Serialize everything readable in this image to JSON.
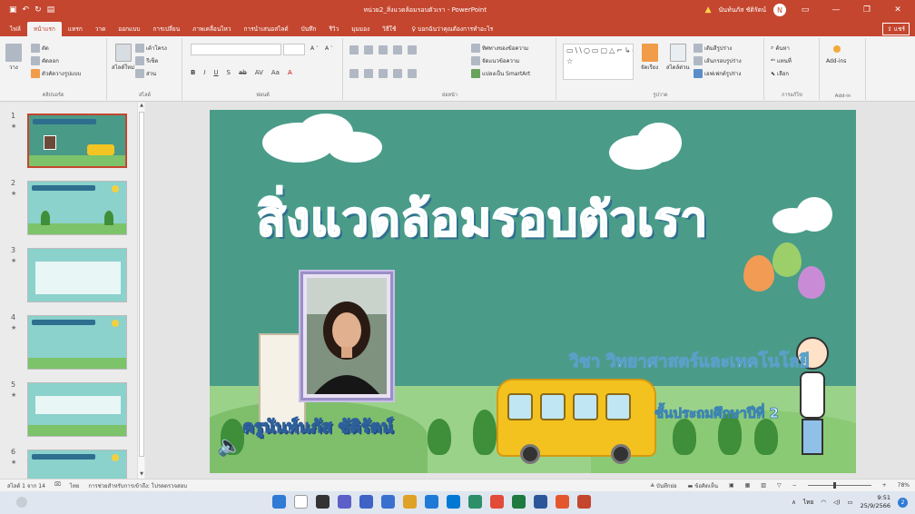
{
  "app": {
    "window_title": "หน่วย2_สิ่งแวดล้อมรอบตัวเรา - PowerPoint",
    "user_name": "นันท์นภัส ชัติรัตน์",
    "avatar_initial": "N",
    "warning_icon": "warning-icon",
    "accent_color": "#c4462f"
  },
  "quick_access": {
    "save_icon": "save-icon",
    "undo_icon": "undo-icon",
    "redo_icon": "redo-icon",
    "present_icon": "present-icon"
  },
  "ribbon_tabs": [
    {
      "label": "ไฟล์"
    },
    {
      "label": "หน้าแรก",
      "active": true
    },
    {
      "label": "แทรก"
    },
    {
      "label": "วาด"
    },
    {
      "label": "ออกแบบ"
    },
    {
      "label": "การเปลี่ยน"
    },
    {
      "label": "ภาพเคลื่อนไหว"
    },
    {
      "label": "การนำเสนอสไลด์"
    },
    {
      "label": "บันทึก"
    },
    {
      "label": "รีวิว"
    },
    {
      "label": "มุมมอง"
    },
    {
      "label": "วิธีใช้"
    }
  ],
  "tell_me": "บอกฉันว่าคุณต้องการทำอะไร",
  "share_label": "แชร์",
  "ribbon": {
    "clipboard": {
      "paste": "วาง",
      "cut": "ตัด",
      "copy": "คัดลอก",
      "format_painter": "ตัวคัดวางรูปแบบ",
      "label": "คลิปบอร์ด"
    },
    "slides": {
      "new_slide": "สไลด์ใหม่",
      "layout": "เค้าโครง",
      "reset": "รีเซ็ต",
      "section": "ส่วน",
      "label": "สไลด์"
    },
    "font": {
      "label": "ฟอนต์",
      "format_buttons": [
        "B",
        "I",
        "U",
        "S",
        "ab",
        "AV",
        "Aa",
        "A"
      ]
    },
    "paragraph": {
      "text_direction": "ทิศทางของข้อความ",
      "align_text": "จัดแนวข้อความ",
      "smartart": "แปลงเป็น SmartArt",
      "label": "ย่อหน้า"
    },
    "drawing": {
      "arrange": "จัดเรียง",
      "quick_styles": "สไตล์ด่วน",
      "shape_fill": "เติมสีรูปร่าง",
      "shape_outline": "เส้นกรอบรูปร่าง",
      "shape_effects": "เอฟเฟกต์รูปร่าง",
      "label": "รูปวาด"
    },
    "editing": {
      "find": "ค้นหา",
      "replace": "แทนที่",
      "select": "เลือก",
      "label": "การแก้ไข"
    },
    "addins": {
      "button": "Add-ins",
      "label": "Add-in"
    }
  },
  "thumbnails": [
    {
      "num": "1",
      "star": "★",
      "selected": true
    },
    {
      "num": "2",
      "star": "★"
    },
    {
      "num": "3",
      "star": "★"
    },
    {
      "num": "4",
      "star": "★"
    },
    {
      "num": "5",
      "star": "★"
    },
    {
      "num": "6",
      "star": "★"
    }
  ],
  "slide": {
    "title": "สิ่งแวดล้อมรอบตัวเรา",
    "subject": "วิชา วิทยาศาสตร์และเทคโนโลยี",
    "grade": "ชั้นประถมศึกษาปีที่ 2",
    "teacher": "ครูนันท์นภัส ชัติรัตน์",
    "background_color": "#4a9c89"
  },
  "status_bar": {
    "slide_info": "สไลด์ 1 จาก 14",
    "language": "ไทย",
    "accessibility": "การช่วยสำหรับการเข้าถึง: โปรดตรวจสอบ",
    "notes": "บันทึกย่อ",
    "comments": "ข้อคิดเห็น",
    "zoom": "78%"
  },
  "taskbar": {
    "time": "9:51",
    "date": "25/9/2566",
    "language": "ไทย",
    "notification_count": "2"
  }
}
